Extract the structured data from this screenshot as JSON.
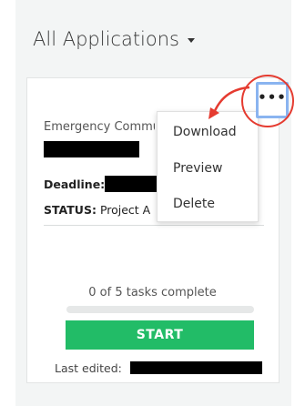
{
  "header": {
    "title": "All Applications"
  },
  "card": {
    "app_name": "Emergency Commu",
    "deadline_label": "Deadline:",
    "status_label": "STATUS:",
    "status_value": "Project A",
    "tasks_text": "0 of 5 tasks complete",
    "tasks_done": 0,
    "tasks_total": 5,
    "start_label": "START",
    "last_edited_label": "Last edited:",
    "more_label": "•••"
  },
  "menu": {
    "items": [
      {
        "label": "Download"
      },
      {
        "label": "Preview"
      },
      {
        "label": "Delete"
      }
    ]
  },
  "colors": {
    "accent_green": "#22bc67",
    "annotation_red": "#e53b30",
    "highlight_blue": "#8ab4f0"
  }
}
